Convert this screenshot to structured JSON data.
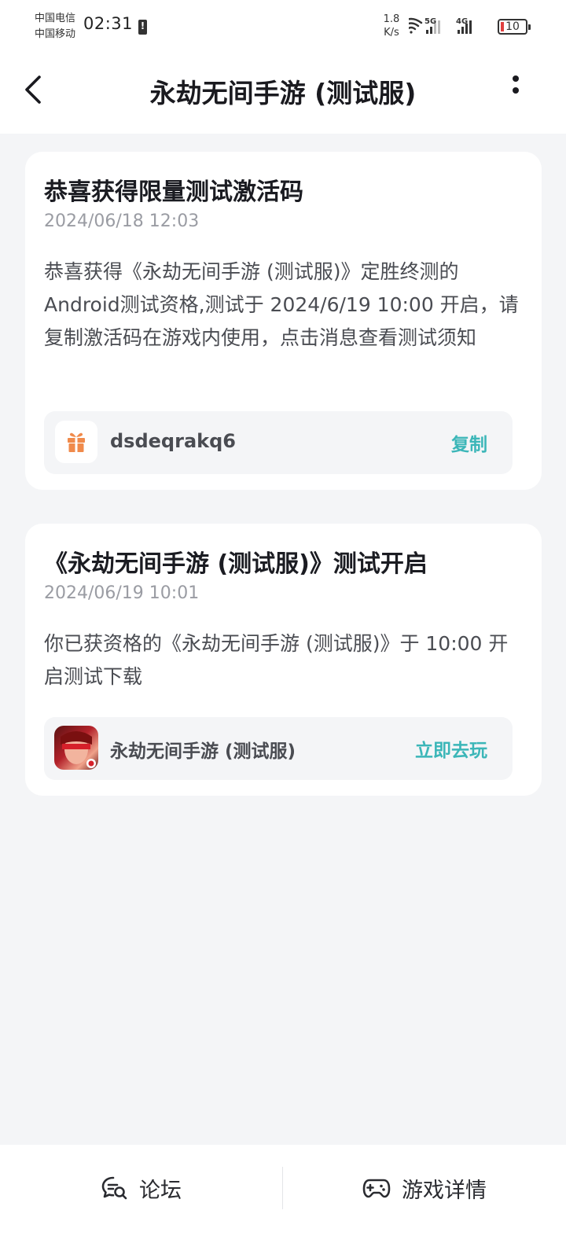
{
  "status_bar": {
    "carrier_1": "中国电信",
    "carrier_2": "中国移动",
    "time": "02:31",
    "net_speed_value": "1.8",
    "net_speed_unit": "K/s",
    "signal_1_label": "5G",
    "signal_2_label": "4G",
    "battery": "10"
  },
  "header": {
    "title": "永劫无间手游 (测试服)"
  },
  "messages": [
    {
      "title": "恭喜获得限量测试激活码",
      "time": "2024/06/18 12:03",
      "body": "恭喜获得《永劫无间手游 (测试服)》定胜终测的Android测试资格,测试于 2024/6/19 10:00 开启，请复制激活码在游戏内使用，点击消息查看测试须知",
      "code": "dsdeqrakq6",
      "action": "复制"
    },
    {
      "title": "《永劫无间手游 (测试服)》测试开启",
      "time": "2024/06/19 10:01",
      "body": "你已获资格的《永劫无间手游 (测试服)》于 10:00 开启测试下载",
      "game_name": "永劫无间手游 (测试服)",
      "action": "立即去玩"
    }
  ],
  "bottom_bar": {
    "forum_label": "论坛",
    "details_label": "游戏详情"
  },
  "colors": {
    "accent": "#3bb6b8",
    "gift": "#f08a4b",
    "background": "#f4f5f7"
  }
}
